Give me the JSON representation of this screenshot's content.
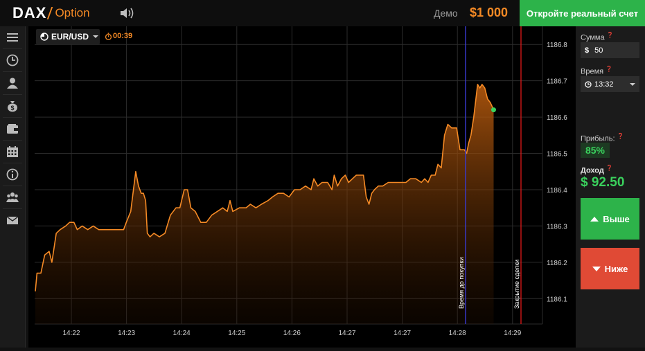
{
  "header": {
    "logo_main": "DAX",
    "logo_sub": "Option",
    "demo_label": "Демо",
    "balance": "$1 000",
    "real_account_button": "Откройте реальный счет"
  },
  "sidebar": {
    "items": [
      {
        "icon": "menu-icon"
      },
      {
        "icon": "clock-icon"
      },
      {
        "icon": "user-icon"
      },
      {
        "icon": "money-bag-icon"
      },
      {
        "icon": "wallet-icon"
      },
      {
        "icon": "calendar-icon"
      },
      {
        "icon": "info-icon"
      },
      {
        "icon": "users-icon"
      },
      {
        "icon": "mail-icon"
      }
    ]
  },
  "toolbar": {
    "pair": "EUR/USD",
    "timer": "00:39"
  },
  "trade_panel": {
    "amount_label": "Сумма",
    "amount_currency": "$",
    "amount_value": "50",
    "time_label": "Время",
    "time_value": "13:32",
    "profit_label": "Прибыль:",
    "profit_value": "85%",
    "income_label": "Доход",
    "income_value": "$ 92.50",
    "up_button": "Выше",
    "down_button": "Ниже"
  },
  "colors": {
    "accent": "#f58a25",
    "green": "#2db34a",
    "red": "#e04a35",
    "purchase_line": "#3a3ad0",
    "close_line": "#d01818"
  },
  "chart_data": {
    "type": "area",
    "y_ticks": [
      "1186.8",
      "1186.7",
      "1186.6",
      "1186.5",
      "1186.4",
      "1186.3",
      "1186.2",
      "1186.1"
    ],
    "ylim": [
      1186.03,
      1186.85
    ],
    "x_ticks": [
      "14:22",
      "14:23",
      "14:24",
      "14:25",
      "14:26",
      "14:27",
      "14:27",
      "14:28",
      "14:29"
    ],
    "markers": [
      {
        "label": "Время до покупки",
        "at_tick": 7.1
      },
      {
        "label": "Закрытие сделки",
        "at_tick": 8.15
      }
    ],
    "grid": true,
    "series": [
      {
        "values": [
          [
            0,
            1186.12
          ],
          [
            0.03,
            1186.17
          ],
          [
            0.1,
            1186.17
          ],
          [
            0.17,
            1186.22
          ],
          [
            0.25,
            1186.23
          ],
          [
            0.3,
            1186.2
          ],
          [
            0.38,
            1186.28
          ],
          [
            0.45,
            1186.29
          ],
          [
            0.55,
            1186.3
          ],
          [
            0.62,
            1186.31
          ],
          [
            0.7,
            1186.31
          ],
          [
            0.76,
            1186.29
          ],
          [
            0.85,
            1186.3
          ],
          [
            0.95,
            1186.29
          ],
          [
            1.05,
            1186.3
          ],
          [
            1.15,
            1186.29
          ],
          [
            1.3,
            1186.29
          ],
          [
            1.5,
            1186.29
          ],
          [
            1.6,
            1186.29
          ],
          [
            1.65,
            1186.31
          ],
          [
            1.73,
            1186.34
          ],
          [
            1.82,
            1186.45
          ],
          [
            1.87,
            1186.41
          ],
          [
            1.92,
            1186.39
          ],
          [
            1.96,
            1186.39
          ],
          [
            2.0,
            1186.37
          ],
          [
            2.03,
            1186.28
          ],
          [
            2.08,
            1186.27
          ],
          [
            2.15,
            1186.28
          ],
          [
            2.25,
            1186.27
          ],
          [
            2.35,
            1186.28
          ],
          [
            2.45,
            1186.33
          ],
          [
            2.55,
            1186.35
          ],
          [
            2.62,
            1186.35
          ],
          [
            2.7,
            1186.4
          ],
          [
            2.76,
            1186.4
          ],
          [
            2.82,
            1186.35
          ],
          [
            2.9,
            1186.34
          ],
          [
            3.0,
            1186.31
          ],
          [
            3.1,
            1186.31
          ],
          [
            3.2,
            1186.33
          ],
          [
            3.3,
            1186.34
          ],
          [
            3.4,
            1186.35
          ],
          [
            3.48,
            1186.34
          ],
          [
            3.53,
            1186.37
          ],
          [
            3.58,
            1186.34
          ],
          [
            3.7,
            1186.35
          ],
          [
            3.82,
            1186.35
          ],
          [
            3.9,
            1186.36
          ],
          [
            4.0,
            1186.35
          ],
          [
            4.1,
            1186.36
          ],
          [
            4.22,
            1186.37
          ],
          [
            4.3,
            1186.38
          ],
          [
            4.4,
            1186.39
          ],
          [
            4.5,
            1186.39
          ],
          [
            4.6,
            1186.38
          ],
          [
            4.7,
            1186.4
          ],
          [
            4.8,
            1186.4
          ],
          [
            4.9,
            1186.41
          ],
          [
            5.0,
            1186.4
          ],
          [
            5.05,
            1186.43
          ],
          [
            5.12,
            1186.41
          ],
          [
            5.2,
            1186.42
          ],
          [
            5.3,
            1186.42
          ],
          [
            5.38,
            1186.4
          ],
          [
            5.42,
            1186.44
          ],
          [
            5.48,
            1186.41
          ],
          [
            5.55,
            1186.43
          ],
          [
            5.62,
            1186.44
          ],
          [
            5.68,
            1186.42
          ],
          [
            5.75,
            1186.43
          ],
          [
            5.82,
            1186.44
          ],
          [
            5.9,
            1186.44
          ],
          [
            5.95,
            1186.44
          ],
          [
            6.0,
            1186.38
          ],
          [
            6.05,
            1186.36
          ],
          [
            6.1,
            1186.39
          ],
          [
            6.15,
            1186.4
          ],
          [
            6.22,
            1186.41
          ],
          [
            6.3,
            1186.41
          ],
          [
            6.4,
            1186.42
          ],
          [
            6.5,
            1186.42
          ],
          [
            6.6,
            1186.42
          ],
          [
            6.72,
            1186.42
          ],
          [
            6.8,
            1186.43
          ],
          [
            6.9,
            1186.43
          ],
          [
            7.0,
            1186.42
          ],
          [
            7.06,
            1186.43
          ],
          [
            7.12,
            1186.42
          ],
          [
            7.18,
            1186.44
          ],
          [
            7.25,
            1186.44
          ],
          [
            7.3,
            1186.47
          ],
          [
            7.36,
            1186.46
          ],
          [
            7.42,
            1186.55
          ],
          [
            7.48,
            1186.58
          ],
          [
            7.55,
            1186.57
          ],
          [
            7.64,
            1186.57
          ],
          [
            7.7,
            1186.51
          ],
          [
            7.78,
            1186.51
          ],
          [
            7.82,
            1186.5
          ],
          [
            7.86,
            1186.53
          ],
          [
            7.9,
            1186.55
          ],
          [
            7.95,
            1186.6
          ],
          [
            8.02,
            1186.69
          ],
          [
            8.06,
            1186.68
          ],
          [
            8.1,
            1186.69
          ],
          [
            8.15,
            1186.68
          ],
          [
            8.2,
            1186.65
          ],
          [
            8.25,
            1186.64
          ],
          [
            8.31,
            1186.62
          ]
        ]
      }
    ]
  }
}
